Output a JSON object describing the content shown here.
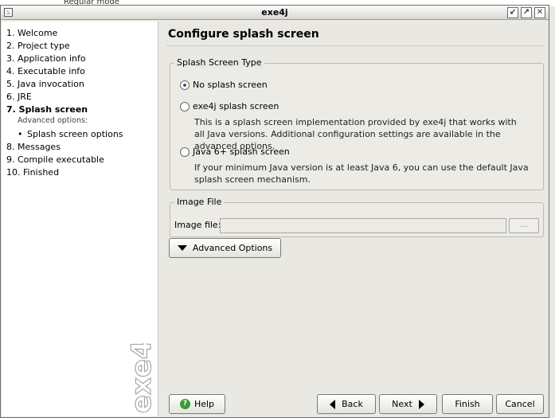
{
  "background": {
    "peek_text": "Regular mode"
  },
  "window": {
    "title": "exe4j",
    "buttons": {
      "minimize": "↙",
      "maximize": "↗",
      "close": "✕"
    }
  },
  "sidebar": {
    "steps": [
      {
        "label": "1. Welcome"
      },
      {
        "label": "2. Project type"
      },
      {
        "label": "3. Application info"
      },
      {
        "label": "4. Executable info"
      },
      {
        "label": "5. Java invocation"
      },
      {
        "label": "6. JRE"
      },
      {
        "label": "7. Splash screen",
        "active": true
      },
      {
        "label": "8. Messages"
      },
      {
        "label": "9. Compile executable"
      },
      {
        "label": "10. Finished"
      }
    ],
    "advanced_label": "Advanced options:",
    "advanced_items": [
      {
        "label": "Splash screen options"
      }
    ],
    "watermark": "exe4j"
  },
  "main": {
    "title": "Configure splash screen",
    "splash_group": {
      "label": "Splash Screen Type",
      "options": [
        {
          "label": "No splash screen",
          "checked": true,
          "desc": ""
        },
        {
          "label": "exe4j splash screen",
          "checked": false,
          "desc": "This is a splash screen implementation provided by exe4j that works with all Java versions. Additional configuration settings are available in the advanced options."
        },
        {
          "label": "Java 6+ splash screen",
          "checked": false,
          "desc": "If your minimum Java version is at least Java 6, you can use the default Java splash screen mechanism."
        }
      ]
    },
    "image_group": {
      "label": "Image File",
      "field_label": "Image file:",
      "field_value": "",
      "browse_label": "..."
    },
    "advanced_button": "Advanced Options"
  },
  "footer": {
    "help": "Help",
    "back": "Back",
    "next": "Next",
    "finish": "Finish",
    "cancel": "Cancel"
  },
  "colors": {
    "window_bg": "#e9e8e2",
    "sidebar_bg": "#ffffff",
    "help_icon": "#3a9a3a",
    "radio_dot": "#3a5a8a"
  }
}
